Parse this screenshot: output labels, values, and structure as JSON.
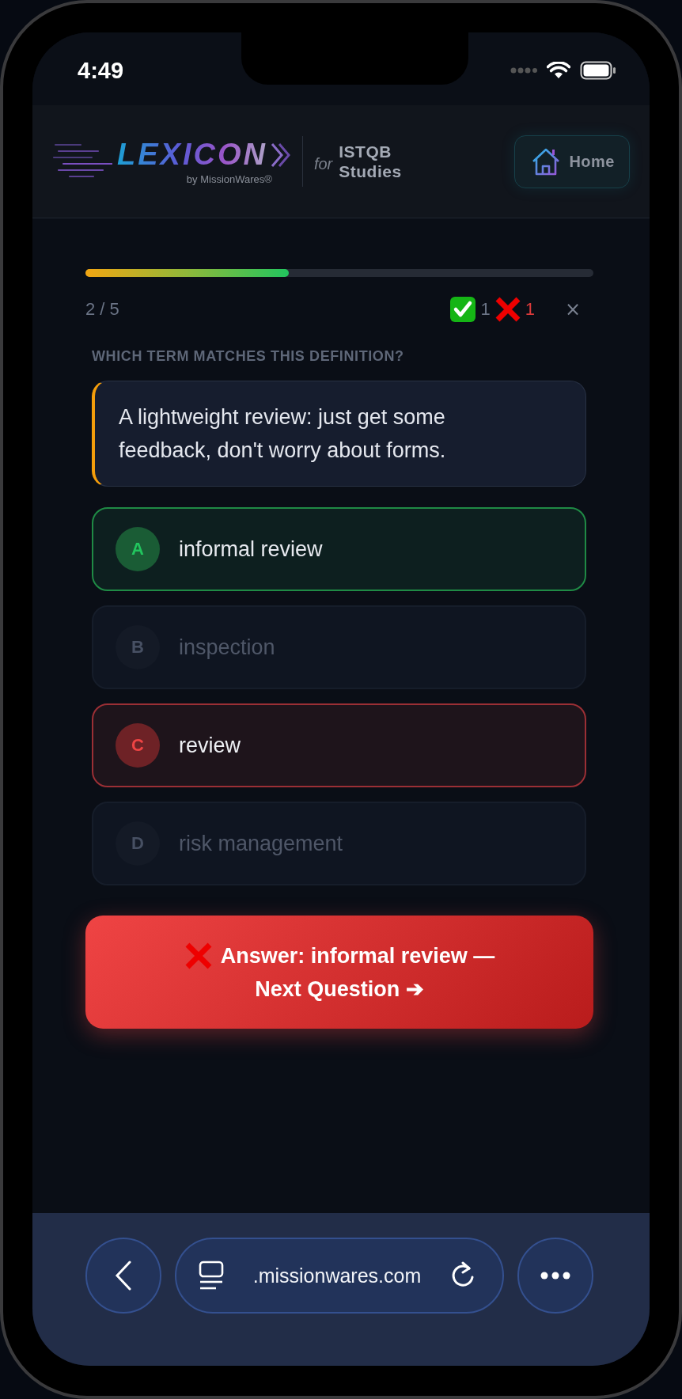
{
  "status_bar": {
    "time": "4:49"
  },
  "header": {
    "logo": "LEXICON",
    "byline": "by MissionWares®",
    "for": "for",
    "subject": [
      "ISTQB",
      "Studies"
    ],
    "home_button": "Home"
  },
  "quiz": {
    "progress": {
      "level": 0.4
    },
    "counter": "2 / 5",
    "correct_count": "1",
    "wrong_count": "1",
    "close": "×"
  },
  "prompt": "WHICH TERM MATCHES THIS DEFINITION?",
  "definition": "A lightweight review: just get some feedback, don't worry about forms.",
  "options": [
    {
      "letter": "A",
      "text": "informal review",
      "correct": true,
      "chosen": false
    },
    {
      "letter": "B",
      "text": "inspection",
      "correct": false,
      "chosen": false
    },
    {
      "letter": "C",
      "text": "review",
      "correct": false,
      "chosen": true
    },
    {
      "letter": "D",
      "text": "risk management",
      "correct": false,
      "chosen": false
    }
  ],
  "next_button": {
    "lines": [
      "Answer: informal review —",
      "Next Question ➔"
    ]
  },
  "browser_bar": {
    "url": ".missionwares.com"
  }
}
